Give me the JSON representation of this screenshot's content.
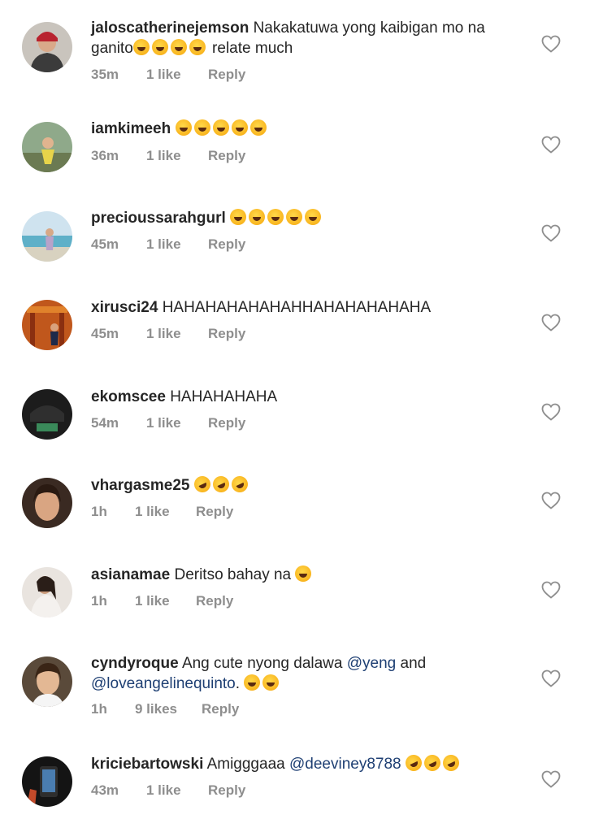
{
  "icons": {
    "like": "heart-outline-icon",
    "emoji_laugh": "tears-of-joy-emoji",
    "emoji_rofl": "rolling-laughing-emoji",
    "emoji_sweat": "grinning-sweat-emoji"
  },
  "comments": [
    {
      "username": "jaloscatherinejemson",
      "text_before": "Nakakatuwa yong kaibigan mo na ganito",
      "text_after": " relate much",
      "time": "35m",
      "likes": "1 like",
      "reply": "Reply"
    },
    {
      "username": "iamkimeeh",
      "time": "36m",
      "likes": "1 like",
      "reply": "Reply"
    },
    {
      "username": "precioussarahgurl",
      "time": "45m",
      "likes": "1 like",
      "reply": "Reply"
    },
    {
      "username": "xirusci24",
      "text": "HAHAHAHAHAHAHHAHAHAHAHAHA",
      "time": "45m",
      "likes": "1 like",
      "reply": "Reply"
    },
    {
      "username": "ekomscee",
      "text": "HAHAHAHAHA",
      "time": "54m",
      "likes": "1 like",
      "reply": "Reply"
    },
    {
      "username": "vhargasme25",
      "time": "1h",
      "likes": "1 like",
      "reply": "Reply"
    },
    {
      "username": "asianamae",
      "text": "Deritso bahay na",
      "time": "1h",
      "likes": "1 like",
      "reply": "Reply"
    },
    {
      "username": "cyndyroque",
      "text_before": "Ang cute nyong dalawa",
      "mention1": "@yeng",
      "text_mid": "and",
      "mention2": "@loveangelinequinto",
      "text_after": ".",
      "time": "1h",
      "likes": "9 likes",
      "reply": "Reply"
    },
    {
      "username": "kriciebartowski",
      "text": "Amigggaaa",
      "mention": "@deeviney8788",
      "time": "43m",
      "likes": "1 like",
      "reply": "Reply"
    }
  ]
}
